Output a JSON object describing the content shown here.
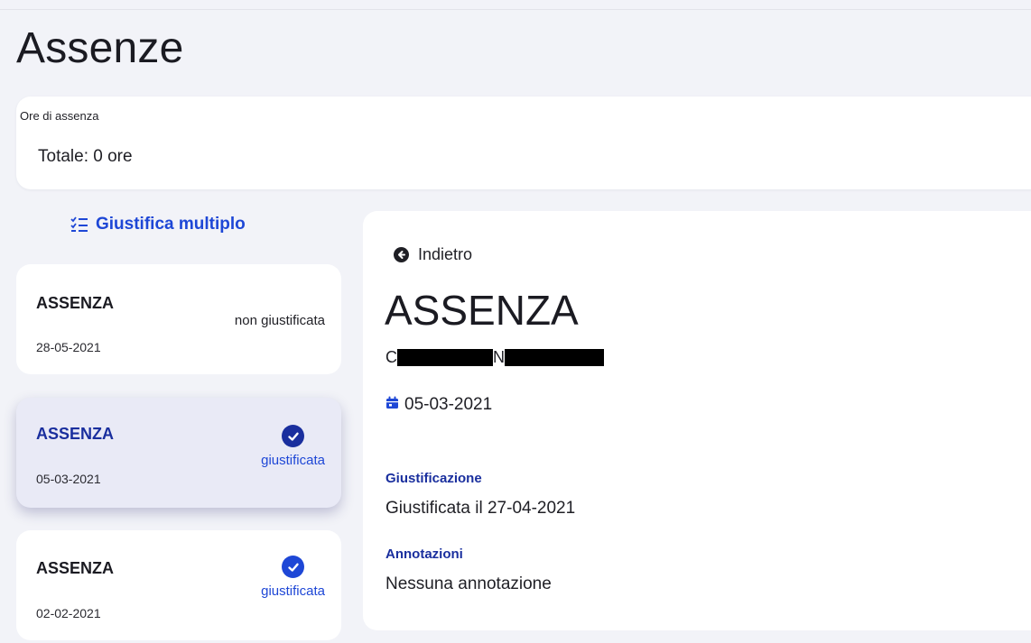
{
  "page": {
    "title": "Assenze"
  },
  "hours_card": {
    "label": "Ore di assenza",
    "total": "Totale: 0 ore"
  },
  "actions": {
    "multi_justify_label": "Giustifica multiplo",
    "multi_justify_icon": "checklist-icon"
  },
  "absences": [
    {
      "title": "ASSENZA",
      "date": "28-05-2021",
      "status": "non giustificata",
      "justified": false,
      "selected": false
    },
    {
      "title": "ASSENZA",
      "date": "05-03-2021",
      "status": "giustificata",
      "justified": true,
      "selected": true
    },
    {
      "title": "ASSENZA",
      "date": "02-02-2021",
      "status": "giustificata",
      "justified": true,
      "selected": false
    }
  ],
  "detail": {
    "back_label": "Indietro",
    "title": "ASSENZA",
    "student_name_initial": "C",
    "student_surname_initial": "N",
    "date": "05-03-2021",
    "justification_label": "Giustificazione",
    "justification_value": "Giustificata il 27-04-2021",
    "notes_label": "Annotazioni",
    "notes_value": "Nessuna annotazione"
  },
  "colors": {
    "accent": "#1e47d6",
    "accent_dark": "#1a2f9e",
    "background": "#f2f3f8",
    "card": "#ffffff",
    "selected_card": "#e9eaf6"
  }
}
